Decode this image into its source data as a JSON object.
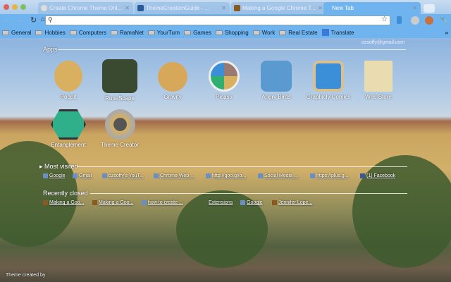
{
  "tabs": [
    {
      "title": "Create Chrome Theme Onl...",
      "active": false
    },
    {
      "title": "ThemeCreationGuide - ...",
      "active": false
    },
    {
      "title": "Making a Google Chrome T...",
      "active": false
    },
    {
      "title": "New Tab",
      "active": true
    }
  ],
  "omnibox": {
    "value": ""
  },
  "bookmarks": [
    "General",
    "Hobbies",
    "Computers",
    "RamaNet",
    "YourTurn",
    "Games",
    "Shopping",
    "Work",
    "Real Estate",
    "Translate"
  ],
  "overflow": "»",
  "user_email": "ozsoffy@gmail.com",
  "apps_header": "Apps",
  "apps": [
    {
      "name": "Poppit",
      "color": "#d9b060"
    },
    {
      "name": "RuneScape",
      "color": "#3a4a30"
    },
    {
      "name": "Gravity",
      "color": "#d8a85a"
    },
    {
      "name": "Picasa",
      "color": "#f0f0f0"
    },
    {
      "name": "Angry Birds",
      "color": "#5a9ad0"
    },
    {
      "name": "Graphicly Comics",
      "color": "#3a8fd8"
    },
    {
      "name": "Web Store",
      "color": "#e8dcb0"
    },
    {
      "name": "Entanglement",
      "color": "#2fb08a"
    },
    {
      "name": "Theme Creator",
      "color": "#8a8a8a"
    }
  ],
  "most_visited_header": "Most visited",
  "most_visited": [
    "Google",
    "Gmail",
    "ozsoffy's YouT...",
    "Chrome Web ...",
    "http://goo.gl/o...",
    "Social Media ...",
    "https://plus.g...",
    "(1) Facebook"
  ],
  "recently_closed_header": "Recently closed",
  "recently_closed": [
    "Making a Goo...",
    "Making a Goo...",
    "how to create ...",
    "Extensions",
    "Google",
    "Jennifer Lope..."
  ],
  "footer": "Theme created by"
}
